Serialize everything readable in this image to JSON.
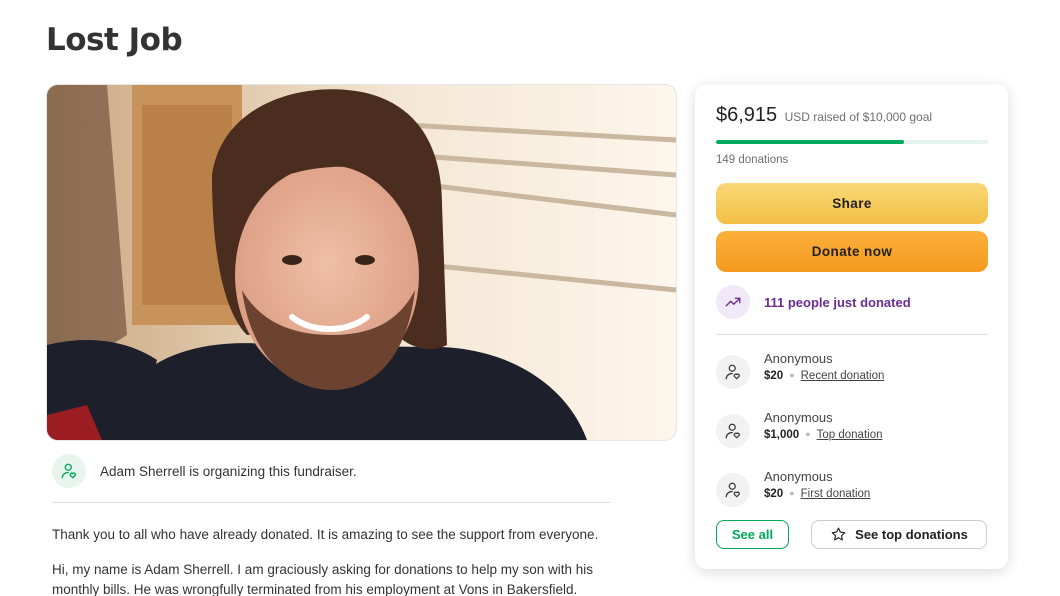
{
  "page_title": "Lost Job",
  "organizer": {
    "text": "Adam Sherrell is organizing this fundraiser.",
    "icon": "person-heart-icon"
  },
  "story": {
    "paragraphs": [
      "Thank you to all who have already donated. It is amazing to see the support from everyone.",
      "Hi, my name is Adam Sherrell. I am graciously asking for donations to help my son with his monthly bills. He was wrongfully terminated from his employment at Vons in Bakersfield."
    ]
  },
  "donation_card": {
    "raised_amount": "$6,915",
    "goal_text": "USD raised of $10,000 goal",
    "progress_fraction": 0.6915,
    "donation_count": "149 donations",
    "share_label": "Share",
    "donate_label": "Donate now",
    "trend_text": "111 people just donated",
    "trend_icon": "trending-up-icon",
    "donors": [
      {
        "name": "Anonymous",
        "amount": "$20",
        "kind": "Recent donation"
      },
      {
        "name": "Anonymous",
        "amount": "$1,000",
        "kind": "Top donation"
      },
      {
        "name": "Anonymous",
        "amount": "$20",
        "kind": "First donation"
      }
    ],
    "see_all_label": "See all",
    "see_top_label": "See top donations"
  },
  "colors": {
    "brand_green": "#02a95c",
    "share_yellow": "#f3bf45",
    "donate_orange": "#f59a1f",
    "trend_purple": "#6b2c91"
  }
}
